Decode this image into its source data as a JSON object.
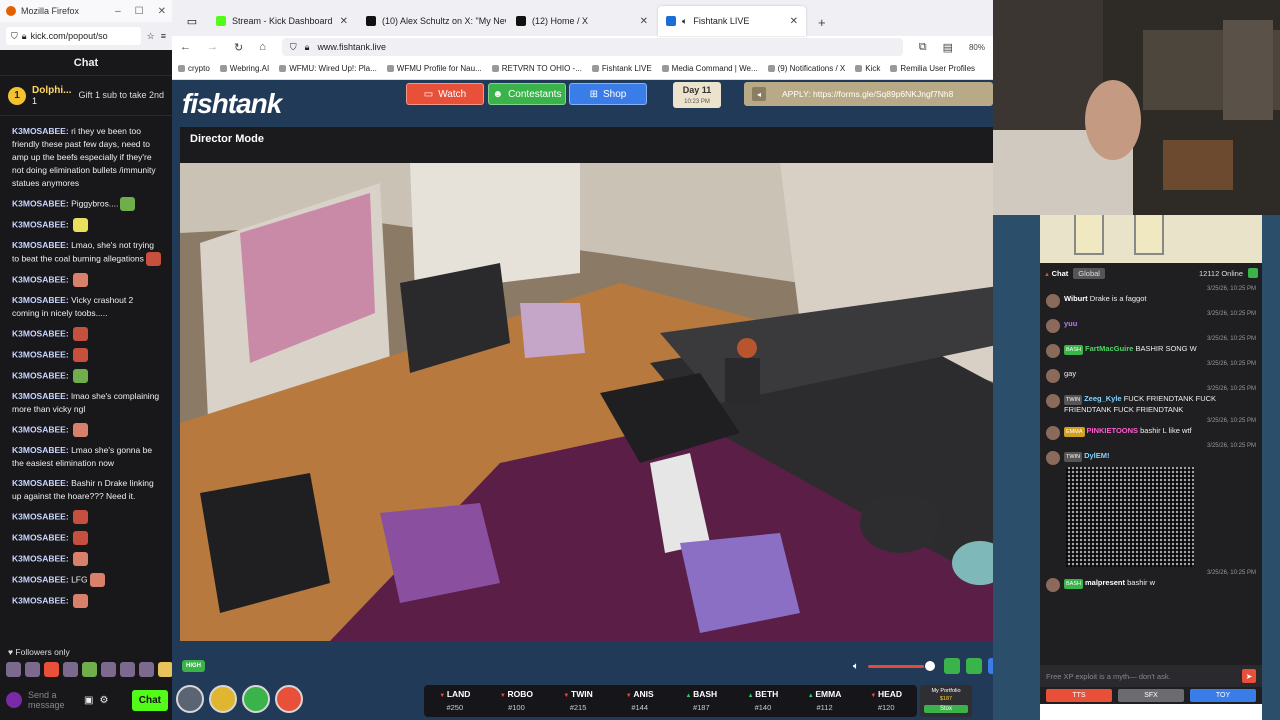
{
  "popout_window": {
    "title": "Mozilla Firefox",
    "url": "kick.com/popout/so",
    "chat_title": "Chat",
    "pinned": {
      "rank": "1",
      "user": "Dolphi...",
      "count": "1",
      "gift_text": "Gift 1 sub to take 2nd"
    },
    "messages": [
      {
        "user": "K3MOSABEE:",
        "text": "ri they ve been too friendly these past few days, need to amp up the beefs especially if they're not doing elimination bullets /immunity statues anymores",
        "emote": ""
      },
      {
        "user": "K3MOSABEE:",
        "text": "Piggybros....",
        "emote": "g"
      },
      {
        "user": "K3MOSABEE:",
        "text": "",
        "emote": "y"
      },
      {
        "user": "K3MOSABEE:",
        "text": "Lmao, she's not trying to beat the coal burning allegations",
        "emote": "r"
      },
      {
        "user": "K3MOSABEE:",
        "text": "",
        "emote": "p"
      },
      {
        "user": "K3MOSABEE:",
        "text": "Vicky crashout 2 coming in nicely toobs.....",
        "emote": ""
      },
      {
        "user": "K3MOSABEE:",
        "text": "",
        "emote": "r"
      },
      {
        "user": "K3MOSABEE:",
        "text": "",
        "emote": "r"
      },
      {
        "user": "K3MOSABEE:",
        "text": "",
        "emote": "g"
      },
      {
        "user": "K3MOSABEE:",
        "text": "lmao she's complaining more than vicky ngl",
        "emote": ""
      },
      {
        "user": "K3MOSABEE:",
        "text": "",
        "emote": "p"
      },
      {
        "user": "K3MOSABEE:",
        "text": "Lmao she's gonna be the easiest elimination now",
        "emote": ""
      },
      {
        "user": "K3MOSABEE:",
        "text": "Bashir n Drake linking up against the hoare??? Need it.",
        "emote": ""
      },
      {
        "user": "K3MOSABEE:",
        "text": "",
        "emote": "r"
      },
      {
        "user": "K3MOSABEE:",
        "text": "",
        "emote": "r"
      },
      {
        "user": "K3MOSABEE:",
        "text": "",
        "emote": "p"
      },
      {
        "user": "K3MOSABEE:",
        "text": "LFG",
        "emote": "p"
      },
      {
        "user": "K3MOSABEE:",
        "text": "",
        "emote": "p"
      }
    ],
    "followers_only": "Followers only",
    "input_placeholder": "Send a message",
    "send_label": "Chat"
  },
  "browser": {
    "tabs": [
      {
        "title": "Stream - Kick Dashboard",
        "icon": "kick-icon",
        "active": false
      },
      {
        "title": "(10) Alex Schultz on X: \"My New",
        "icon": "x-icon",
        "active": false
      },
      {
        "title": "(12) Home / X",
        "icon": "x-icon",
        "active": false
      },
      {
        "title": "Fishtank LIVE",
        "icon": "fishtank-icon",
        "active": true
      }
    ],
    "url": "www.fishtank.live",
    "zoom": "80%",
    "bookmarks": [
      "crypto",
      "Webring.AI",
      "WFMU: Wired Up!: Pla...",
      "WFMU Profile for Nau...",
      "RETVRN TO OHIO -...",
      "Fishtank LIVE",
      "Media Command | We...",
      "(9) Notifications / X",
      "Kick",
      "Remilia User Profiles"
    ]
  },
  "fishtank": {
    "logo": "fishtank",
    "nav": {
      "watch": "Watch",
      "contestants": "Contestants",
      "shop": "Shop"
    },
    "day": "Day 11",
    "time": "10:23 PM",
    "apply_text": "APPLY: https://forms.gle/Sq89p6NKJngf7Nh8",
    "director_mode": "Director Mode",
    "quality_badge": "HIGH",
    "volume_fraction": 0.9,
    "ticker": [
      {
        "name": "LAND",
        "rank": "#250",
        "dir": "dn"
      },
      {
        "name": "ROBO",
        "rank": "#100",
        "dir": "dn"
      },
      {
        "name": "TWIN",
        "rank": "#215",
        "dir": "dn"
      },
      {
        "name": "ANIS",
        "rank": "#144",
        "dir": "dn"
      },
      {
        "name": "BASH",
        "rank": "#187",
        "dir": "up"
      },
      {
        "name": "BETH",
        "rank": "#140",
        "dir": "up"
      },
      {
        "name": "EMMA",
        "rank": "#112",
        "dir": "up"
      },
      {
        "name": "HEAD",
        "rank": "#120",
        "dir": "dn"
      }
    ],
    "portfolio": {
      "label": "My Portfolio",
      "value": "$187",
      "button": "Stox"
    },
    "colors": {
      "watch": "#e8503a",
      "contestants": "#3ab34a",
      "shop": "#3a7de8",
      "bg": "#213a57"
    }
  },
  "side_chat": {
    "tab_label": "Chat",
    "global_label": "Global",
    "online": "12112 Online",
    "messages": [
      {
        "time": "3/25/26, 10:25 PM",
        "clan": "",
        "user": "Wiburt",
        "color": "#ffffff",
        "text": "Drake is a faggot"
      },
      {
        "time": "3/25/26, 10:25 PM",
        "clan": "",
        "user": "yuu",
        "color": "#b57aff",
        "text": ""
      },
      {
        "time": "3/25/26, 10:25 PM",
        "clan": "BASH",
        "user": "FartMacGuire",
        "color": "#4cd964",
        "text": "BASHIR SONG W"
      },
      {
        "time": "3/25/26, 10:25 PM",
        "clan": "",
        "user": "",
        "color": "#3a5bd6",
        "text": "gay"
      },
      {
        "time": "3/25/26, 10:25 PM",
        "clan": "TWIN",
        "user": "Zeeg_Kyle",
        "color": "#7fd4ff",
        "text": "FUCK FRIENDTANK FUCK FRIENDTANK FUCK FRIENDTANK"
      },
      {
        "time": "3/25/26, 10:25 PM",
        "clan": "EMMA",
        "user": "PINKIETOONS",
        "color": "#ff5bd0",
        "text": "bashir L like wtf"
      },
      {
        "time": "3/25/26, 10:25 PM",
        "clan": "TWIN",
        "user": "DylEM!",
        "color": "#7fd4ff",
        "text": ""
      },
      {
        "time": "3/25/26, 10:25 PM",
        "clan": "BASH",
        "user": "malpresent",
        "color": "#ffffff",
        "text": "bashir w"
      }
    ],
    "input_placeholder": "Free XP exploit is a myth— don't ask.",
    "bottom_tabs": [
      {
        "label": "TTS",
        "color": "#e8503a"
      },
      {
        "label": "SFX",
        "color": "#6b6b70"
      },
      {
        "label": "TOY",
        "color": "#3a7de8"
      }
    ]
  }
}
